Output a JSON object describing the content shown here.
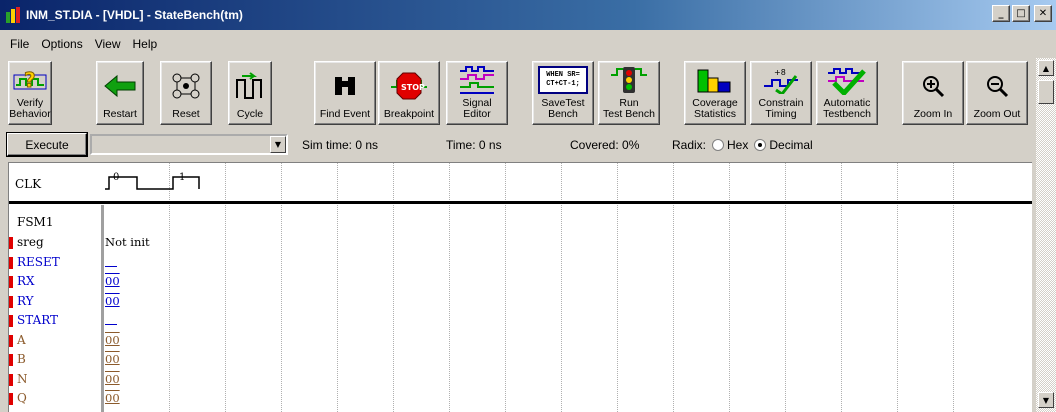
{
  "title_bar": {
    "title": "INM_ST.DIA - [VHDL] - StateBench(tm)",
    "minimize": "_",
    "maximize": "□",
    "close": "✕"
  },
  "menu": {
    "items": [
      "File",
      "Options",
      "View",
      "Help"
    ]
  },
  "toolbar": {
    "buttons": [
      {
        "label": "Verify\nBehavior",
        "icon": "verify-behavior-icon"
      },
      {
        "label": "Restart",
        "icon": "restart-arrow-icon"
      },
      {
        "label": "Reset",
        "icon": "reset-fsm-icon"
      },
      {
        "label": "Cycle",
        "icon": "cycle-clock-icon"
      },
      {
        "label": "Find Event",
        "icon": "binoculars-icon"
      },
      {
        "label": "Breakpoint",
        "icon": "stop-sign-icon"
      },
      {
        "label": "Signal\nEditor",
        "icon": "signal-editor-icon"
      },
      {
        "label": "SaveTest\nBench",
        "icon": "save-testbench-icon"
      },
      {
        "label": "Run\nTest Bench",
        "icon": "traffic-light-icon"
      },
      {
        "label": "Coverage\nStatistics",
        "icon": "coverage-bars-icon"
      },
      {
        "label": "Constrain\nTiming",
        "icon": "constrain-timing-icon"
      },
      {
        "label": "Automatic\nTestbench",
        "icon": "checkmark-wave-icon"
      },
      {
        "label": "Zoom In",
        "icon": "zoom-in-icon"
      },
      {
        "label": "Zoom Out",
        "icon": "zoom-out-icon"
      }
    ],
    "save_icon_text": "WHEN SR=\nCT+CT-1;"
  },
  "exec_row": {
    "execute_label": "Execute",
    "command_value": "",
    "sim_time": "Sim time: 0 ns",
    "time": "Time: 0 ns",
    "covered": "Covered: 0%",
    "radix_label": "Radix:",
    "radix_options": [
      "Hex",
      "Decimal"
    ],
    "radix_selected": "Decimal"
  },
  "waveform": {
    "clock": {
      "name": "CLK",
      "values": [
        "0",
        "1"
      ]
    },
    "group": "FSM1",
    "signals": [
      {
        "name": "sreg",
        "value": "Not init",
        "color": "#000000"
      },
      {
        "name": "RESET",
        "value": "",
        "color": "#0000cc"
      },
      {
        "name": "RX",
        "value": "00",
        "color": "#0000cc"
      },
      {
        "name": "RY",
        "value": "00",
        "color": "#0000cc"
      },
      {
        "name": "START",
        "value": "",
        "color": "#0000cc"
      },
      {
        "name": "A",
        "value": "00",
        "color": "#8b5a2b"
      },
      {
        "name": "B",
        "value": "00",
        "color": "#8b5a2b"
      },
      {
        "name": "N",
        "value": "00",
        "color": "#8b5a2b"
      },
      {
        "name": "Q",
        "value": "00",
        "color": "#8b5a2b"
      }
    ]
  },
  "colors": {
    "title_start": "#0a246a",
    "title_end": "#a6caf0",
    "marker": "#e00000",
    "input_signal": "#0000cc",
    "output_signal": "#8b5a2b"
  }
}
